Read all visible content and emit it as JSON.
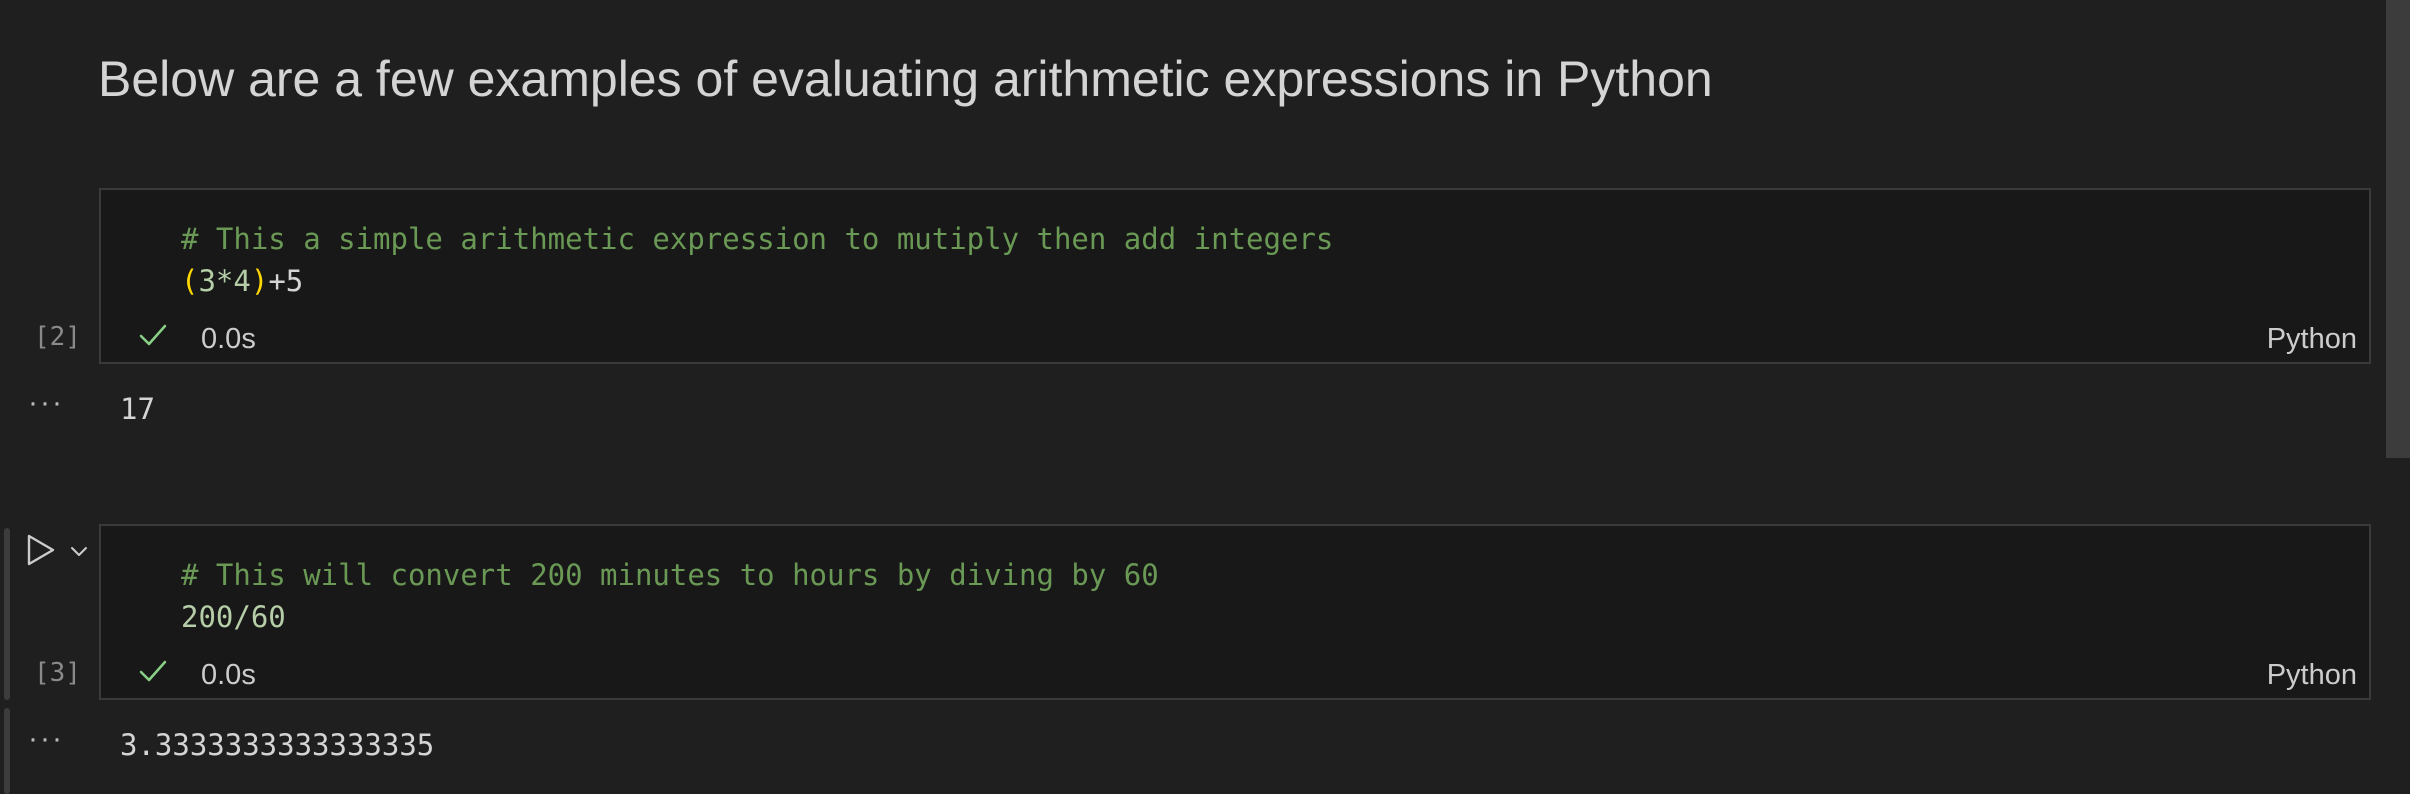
{
  "markdown": {
    "heading": "Below are a few examples of evaluating arithmetic expressions in Python"
  },
  "cells": [
    {
      "exec_count": "[2]",
      "code_lines": {
        "comment": "# This a simple arithmetic expression to mutiply then add integers",
        "expr": {
          "open_paren": "(",
          "inner": "3*4",
          "close_paren": ")",
          "rest": "+5"
        }
      },
      "status_time": "0.0s",
      "language": "Python",
      "output": "17"
    },
    {
      "exec_count": "[3]",
      "code_lines": {
        "comment": "# This will convert 200 minutes to hours by diving by 60",
        "expr": "200/60"
      },
      "status_time": "0.0s",
      "language": "Python",
      "output": "3.3333333333333335"
    }
  ],
  "output_marker": "···",
  "icons": {
    "run": "run-icon",
    "chevron": "chevron-down-icon",
    "check": "check-icon"
  },
  "colors": {
    "comment": "#6a9955",
    "paren": "#ffd700",
    "number": "#b5cea8",
    "success": "#89d185"
  }
}
